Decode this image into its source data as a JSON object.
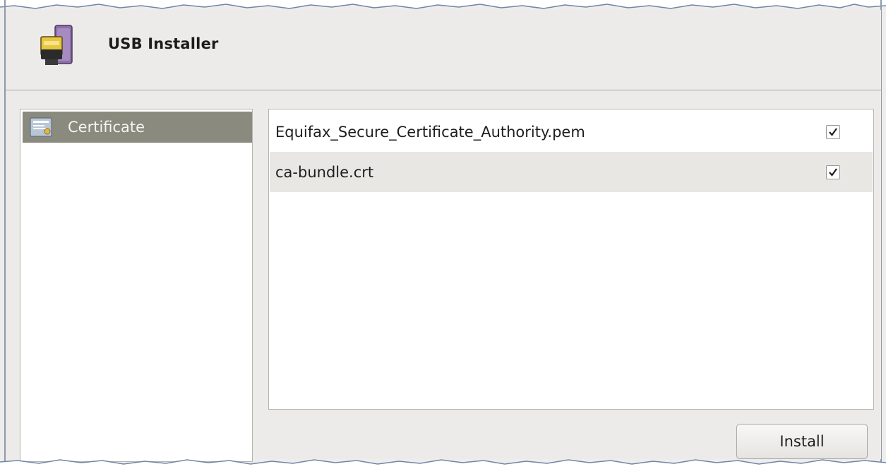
{
  "window": {
    "title": "USB Installer",
    "icon": "usb-drive-icon"
  },
  "sidebar": {
    "items": [
      {
        "label": "Certificate",
        "icon": "certificate-icon",
        "selected": true
      }
    ]
  },
  "certificates": [
    {
      "name": "Equifax_Secure_Certificate_Authority.pem",
      "checked": true
    },
    {
      "name": "ca-bundle.crt",
      "checked": true
    }
  ],
  "actions": {
    "install_label": "Install"
  },
  "colors": {
    "window_bg": "#edebe9",
    "selected_nav_bg": "#8a8a7e",
    "alt_row_bg": "#e9e7e4",
    "border": "#b7b4b0"
  }
}
